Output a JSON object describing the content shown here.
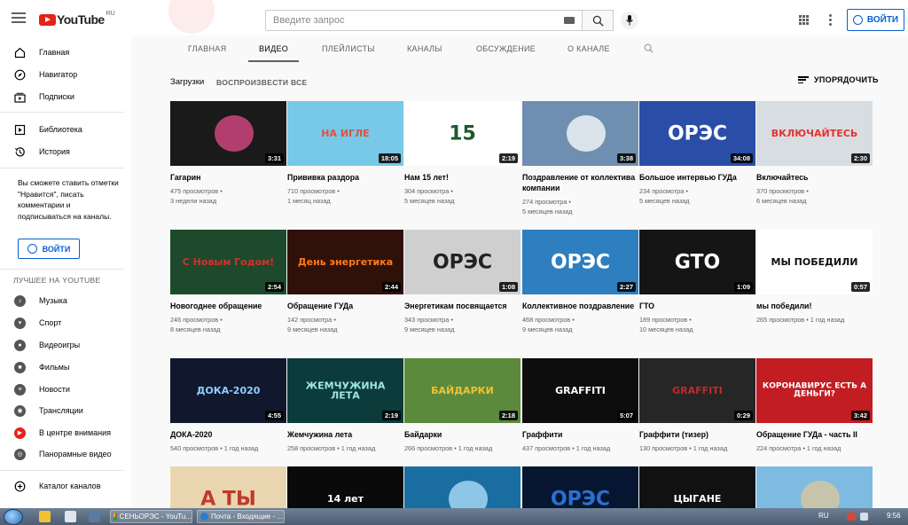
{
  "app": {
    "logo_text": "YouTube",
    "region": "RU"
  },
  "search": {
    "placeholder": "Введите запрос"
  },
  "header": {
    "signin_label": "ВОЙТИ"
  },
  "sidebar": {
    "main": [
      {
        "label": "Главная",
        "icon": "home-icon"
      },
      {
        "label": "Навигатор",
        "icon": "compass-icon"
      },
      {
        "label": "Подписки",
        "icon": "subscriptions-icon"
      }
    ],
    "library": [
      {
        "label": "Библиотека",
        "icon": "library-icon"
      },
      {
        "label": "История",
        "icon": "history-icon"
      }
    ],
    "note": "Вы сможете ставить отметки \"Нравится\", писать комментарии и подписываться на каналы.",
    "login_label": "ВОЙТИ",
    "best_heading": "ЛУЧШЕЕ НА YOUTUBE",
    "best": [
      {
        "label": "Музыка",
        "icon": "music-icon"
      },
      {
        "label": "Спорт",
        "icon": "trophy-icon"
      },
      {
        "label": "Видеоигры",
        "icon": "gamepad-icon"
      },
      {
        "label": "Фильмы",
        "icon": "film-icon"
      },
      {
        "label": "Новости",
        "icon": "news-icon"
      },
      {
        "label": "Трансляции",
        "icon": "live-icon"
      },
      {
        "label": "В центре внимания",
        "icon": "youtube-icon"
      },
      {
        "label": "Панорамные видео",
        "icon": "360-icon"
      }
    ],
    "catalog_label": "Каталог каналов"
  },
  "tabs": [
    {
      "label": "ГЛАВНАЯ",
      "active": false
    },
    {
      "label": "ВИДЕО",
      "active": true
    },
    {
      "label": "ПЛЕЙЛИСТЫ",
      "active": false
    },
    {
      "label": "КАНАЛЫ",
      "active": false
    },
    {
      "label": "ОБСУЖДЕНИЕ",
      "active": false
    },
    {
      "label": "О КАНАЛЕ",
      "active": false
    }
  ],
  "content": {
    "section_title": "Загрузки",
    "play_all": "ВОСПРОИЗВЕСТИ ВСЕ",
    "sort_label": "УПОРЯДОЧИТЬ"
  },
  "videos": [
    {
      "title": "Гагарин",
      "views": "475 просмотров •",
      "age": "3 недели назад",
      "duration": "3:31",
      "thumb_text": "",
      "bg": "#1a1a1a",
      "accent": "#e54b8e"
    },
    {
      "title": "Прививка раздора",
      "views": "710 просмотров •",
      "age": "1 месяц назад",
      "duration": "18:05",
      "thumb_text": "НА ИГЛЕ",
      "bg": "#78c8e8",
      "accent": "#d9533f"
    },
    {
      "title": "Нам 15 лет!",
      "views": "304 просмотра •",
      "age": "5 месяцев назад",
      "duration": "2:19",
      "thumb_text": "15",
      "bg": "#ffffff",
      "accent": "#1c5a2c"
    },
    {
      "title": "Поздравление от коллектива компании",
      "views": "274 просмотра •",
      "age": "5 месяцев назад",
      "duration": "3:38",
      "thumb_text": "",
      "bg": "#6f8fb0",
      "accent": "#ffffff"
    },
    {
      "title": "Большое интервью ГУДа",
      "views": "234 просмотра •",
      "age": "5 месяцев назад",
      "duration": "34:08",
      "thumb_text": "ОРЭС",
      "bg": "#2a4ea8",
      "accent": "#ffffff"
    },
    {
      "title": "Включайтесь",
      "views": "370 просмотров •",
      "age": "6 месяцев назад",
      "duration": "2:30",
      "thumb_text": "ВКЛЮЧАЙТЕСЬ",
      "bg": "#d8dde2",
      "accent": "#e3342f"
    },
    {
      "title": "Новогоднее обращение",
      "views": "246 просмотров •",
      "age": "8 месяцев назад",
      "duration": "2:54",
      "thumb_text": "С Новым Годом!",
      "bg": "#1d4a2c",
      "accent": "#d32f2f"
    },
    {
      "title": "Обращение ГУДа",
      "views": "142 просмотра •",
      "age": "9 месяцев назад",
      "duration": "2:44",
      "thumb_text": "День энергетика",
      "bg": "#30110a",
      "accent": "#ff7a1a"
    },
    {
      "title": "Энергетикам посвящается",
      "views": "343 просмотра •",
      "age": "9 месяцев назад",
      "duration": "1:08",
      "thumb_text": "ОРЭС",
      "bg": "#cfcfcf",
      "accent": "#222222"
    },
    {
      "title": "Коллективное поздравление",
      "views": "468 просмотров •",
      "age": "9 месяцев назад",
      "duration": "2:27",
      "thumb_text": "ОРЭС",
      "bg": "#2e7fbf",
      "accent": "#ffffff"
    },
    {
      "title": "ГТО",
      "views": "189 просмотров •",
      "age": "10 месяцев назад",
      "duration": "1:09",
      "thumb_text": "GTO",
      "bg": "#151515",
      "accent": "#ffffff"
    },
    {
      "title": "мы победили!",
      "views": "265 просмотров • 1 год назад",
      "age": "",
      "duration": "0:57",
      "thumb_text": "МЫ ПОБЕДИЛИ",
      "bg": "#ffffff",
      "accent": "#111111"
    },
    {
      "title": "ДОКА-2020",
      "views": "540 просмотров • 1 год назад",
      "age": "",
      "duration": "4:55",
      "thumb_text": "ДОКА-2020",
      "bg": "#10182e",
      "accent": "#8fd0ff"
    },
    {
      "title": "Жемчужина лета",
      "views": "258 просмотров • 1 год назад",
      "age": "",
      "duration": "2:19",
      "thumb_text": "ЖЕМЧУЖИНА ЛЕТА",
      "bg": "#0b3b3a",
      "accent": "#9fe5e2"
    },
    {
      "title": "Байдарки",
      "views": "266 просмотров • 1 год назад",
      "age": "",
      "duration": "2:18",
      "thumb_text": "БАЙДАРКИ",
      "bg": "#5c8a3c",
      "accent": "#f2c230"
    },
    {
      "title": "Граффити",
      "views": "437 просмотров • 1 год назад",
      "age": "",
      "duration": "5:07",
      "thumb_text": "GRAFFITI",
      "bg": "#0d0d0d",
      "accent": "#ffffff"
    },
    {
      "title": "Граффити (тизер)",
      "views": "130 просмотров • 1 год назад",
      "age": "",
      "duration": "0:29",
      "thumb_text": "GRAFFITI",
      "bg": "#262626",
      "accent": "#c62828"
    },
    {
      "title": "Обращение ГУДа - часть II",
      "views": "224 просмотра • 1 год назад",
      "age": "",
      "duration": "3:42",
      "thumb_text": "КОРОНАВИРУС ЕСТЬ А ДЕНЬГИ?",
      "bg": "#c21d22",
      "accent": "#ffffff"
    },
    {
      "title": "",
      "views": "",
      "age": "",
      "duration": "",
      "thumb_text": "А ТЫ",
      "bg": "#e9d6b0",
      "accent": "#c0392b"
    },
    {
      "title": "",
      "views": "",
      "age": "",
      "duration": "",
      "thumb_text": "14 лет",
      "bg": "#0a0a0a",
      "accent": "#ffffff"
    },
    {
      "title": "",
      "views": "",
      "age": "",
      "duration": "",
      "thumb_text": "",
      "bg": "#1a6da0",
      "accent": "#b5e4ff"
    },
    {
      "title": "",
      "views": "",
      "age": "",
      "duration": "",
      "thumb_text": "ОРЭС",
      "bg": "#061630",
      "accent": "#2d6fd1"
    },
    {
      "title": "",
      "views": "",
      "age": "",
      "duration": "",
      "thumb_text": "ЦЫГАНЕ",
      "bg": "#111111",
      "accent": "#ffffff"
    },
    {
      "title": "",
      "views": "",
      "age": "",
      "duration": "",
      "thumb_text": "",
      "bg": "#7dbbe0",
      "accent": "#e2c79a"
    }
  ],
  "taskbar": {
    "tasks": [
      "СЕНЬОРЭС - YouTu...",
      "Почта - Входящие - ..."
    ],
    "lang": "RU",
    "clock": "9:56"
  }
}
